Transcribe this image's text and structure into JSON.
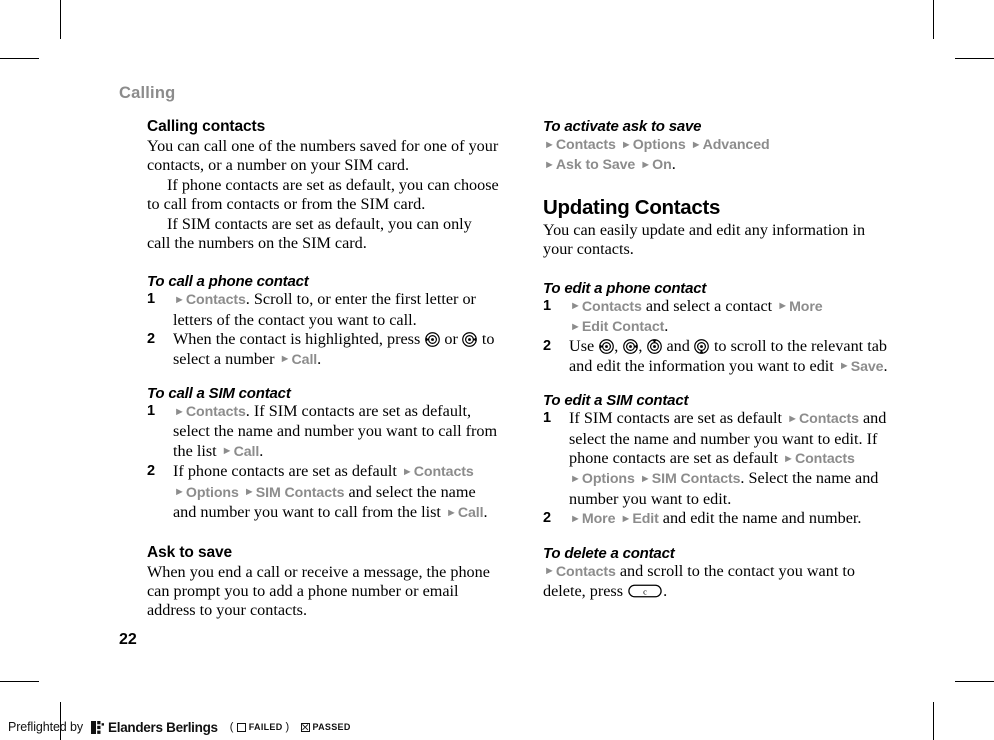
{
  "page": {
    "running_header": "Calling",
    "number": "22"
  },
  "left_column": {
    "section_calling_contacts": {
      "heading": "Calling contacts",
      "paragraphs": [
        "You can call one of the numbers saved for one of your contacts, or a number on your SIM card.",
        "If phone contacts are set as default, you can choose to call from contacts or from the SIM card.",
        "If SIM contacts are set as default, you can only call the numbers on the SIM card."
      ]
    },
    "task_call_phone_contact": {
      "heading": "To call a phone contact",
      "step1": {
        "num": "1",
        "menu_contacts": "Contacts",
        "text_after": ". Scroll to, or enter the first letter or letters of the contact you want to call."
      },
      "step2": {
        "num": "2",
        "text_before": "When the contact is highlighted, press ",
        "text_middle": " or ",
        "text_after": " to select a number ",
        "menu_call": "Call",
        "text_end": ".",
        "icon_left": "nav-key-left-icon",
        "icon_right": "nav-key-right-icon"
      }
    },
    "task_call_sim_contact": {
      "heading": "To call a SIM contact",
      "step1": {
        "num": "1",
        "menu_contacts": "Contacts",
        "text_mid": ". If SIM contacts are set as default, select the name and number you want to call from the list ",
        "menu_call": "Call",
        "text_end": "."
      },
      "step2": {
        "num": "2",
        "text_before": "If phone contacts are set as default ",
        "menu_contacts": "Contacts",
        "menu_options": "Options",
        "menu_sim_contacts": "SIM Contacts",
        "text_mid": " and select the name and number you want to call from the list ",
        "menu_call": "Call",
        "text_end": "."
      }
    },
    "section_ask_to_save": {
      "heading": "Ask to save",
      "paragraph": "When you end a call or receive a message, the phone can prompt you to add a phone number or email address to your contacts."
    }
  },
  "right_column": {
    "task_activate_ask_to_save": {
      "heading": "To activate ask to save",
      "menu_contacts": "Contacts",
      "menu_options": "Options",
      "menu_advanced": "Advanced",
      "menu_ask_to_save": "Ask to Save",
      "menu_on": "On",
      "text_end": "."
    },
    "section_updating_contacts": {
      "heading": "Updating Contacts",
      "paragraph": "You can easily update and edit any information in your contacts."
    },
    "task_edit_phone_contact": {
      "heading": "To edit a phone contact",
      "step1": {
        "num": "1",
        "menu_contacts": "Contacts",
        "text_mid": " and select a contact ",
        "menu_more": "More",
        "menu_edit_contact": "Edit Contact",
        "text_end": "."
      },
      "step2": {
        "num": "2",
        "text_use": "Use ",
        "sep_comma": ", ",
        "text_and": " and ",
        "text_after": " to scroll to the relevant tab and edit the information you want to edit ",
        "menu_save": "Save",
        "text_end": ".",
        "icon_left": "nav-key-left-icon",
        "icon_right": "nav-key-right-icon",
        "icon_up": "nav-key-up-icon",
        "icon_down": "nav-key-down-icon"
      }
    },
    "task_edit_sim_contact": {
      "heading": "To edit a SIM contact",
      "step1": {
        "num": "1",
        "text_before": "If SIM contacts are set as default ",
        "menu_contacts": "Contacts",
        "text_mid": " and select the name and number you want to edit. If phone contacts are set as default ",
        "menu_contacts2": "Contacts",
        "menu_options": "Options",
        "menu_sim_contacts": "SIM Contacts",
        "text_end": ". Select the name and number you want to edit."
      },
      "step2": {
        "num": "2",
        "menu_more": "More",
        "menu_edit": "Edit",
        "text_end": " and edit the name and number."
      }
    },
    "task_delete_contact": {
      "heading": "To delete a contact",
      "menu_contacts": "Contacts",
      "text_mid": " and scroll to the contact you want to delete, press ",
      "key_clear": "c",
      "text_end": "."
    }
  },
  "preflight_footer": {
    "label": "Preflighted by",
    "logo_icon": "elanders-logo-icon",
    "vendor": "Elanders Berlings",
    "paren_open": "(",
    "failed_label": "FAILED",
    "paren_close": ")",
    "passed_label": "PASSED"
  },
  "colors": {
    "menu_gray": "#8c8c8c",
    "header_gray": "#8c8c8c",
    "text_black": "#000000",
    "page_bg": "#ffffff"
  }
}
